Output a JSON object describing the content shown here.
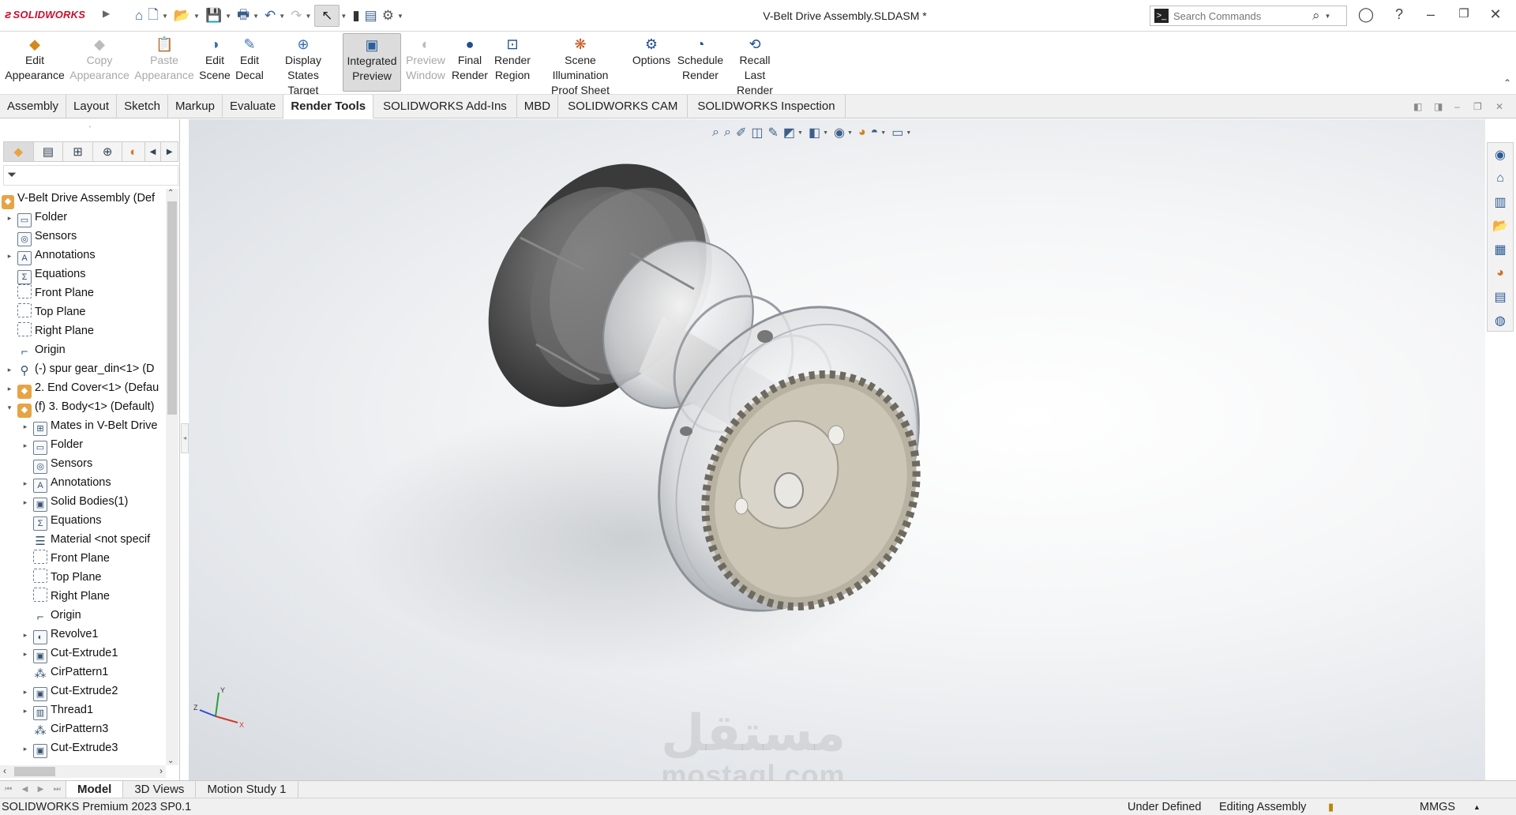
{
  "app": {
    "logo_text": "SOLIDWORKS",
    "window_title": "V-Belt Drive Assembly.SLDASM *"
  },
  "search": {
    "placeholder": "Search Commands"
  },
  "ribbon": {
    "buttons": [
      {
        "line1": "Edit",
        "line2": "Appearance",
        "icon": "edit-appearance-icon",
        "enabled": true
      },
      {
        "line1": "Copy",
        "line2": "Appearance",
        "icon": "copy-appearance-icon",
        "enabled": false
      },
      {
        "line1": "Paste",
        "line2": "Appearance",
        "icon": "paste-appearance-icon",
        "enabled": false
      },
      {
        "line1": "Edit",
        "line2": "Scene",
        "icon": "edit-scene-icon",
        "enabled": true
      },
      {
        "line1": "Edit",
        "line2": "Decal",
        "icon": "edit-decal-icon",
        "enabled": true
      },
      {
        "line1": "Display States",
        "line2": "Target",
        "icon": "display-states-target-icon",
        "enabled": true
      },
      {
        "line1": "Integrated",
        "line2": "Preview",
        "icon": "integrated-preview-icon",
        "enabled": true,
        "active": true
      },
      {
        "line1": "Preview",
        "line2": "Window",
        "icon": "preview-window-icon",
        "enabled": false
      },
      {
        "line1": "Final",
        "line2": "Render",
        "icon": "final-render-icon",
        "enabled": true
      },
      {
        "line1": "Render",
        "line2": "Region",
        "icon": "render-region-icon",
        "enabled": true
      },
      {
        "line1": "Scene Illumination",
        "line2": "Proof Sheet",
        "icon": "scene-illumination-icon",
        "enabled": true
      },
      {
        "line1": "Options",
        "line2": "",
        "icon": "options-icon",
        "enabled": true
      },
      {
        "line1": "Schedule",
        "line2": "Render",
        "icon": "schedule-render-icon",
        "enabled": true
      },
      {
        "line1": "Recall Last",
        "line2": "Render",
        "icon": "recall-last-render-icon",
        "enabled": true
      }
    ]
  },
  "command_tabs": [
    "Assembly",
    "Layout",
    "Sketch",
    "Markup",
    "Evaluate",
    "Render Tools",
    "SOLIDWORKS Add-Ins",
    "MBD",
    "SOLIDWORKS CAM",
    "SOLIDWORKS Inspection"
  ],
  "active_command_tab": "Render Tools",
  "tree": {
    "root": "V-Belt Drive Assembly  (Def",
    "items": [
      {
        "label": "Folder",
        "level": 0,
        "toggle": "▸",
        "icon": "folder-icon"
      },
      {
        "label": "Sensors",
        "level": 0,
        "toggle": "",
        "icon": "sensors-icon"
      },
      {
        "label": "Annotations",
        "level": 0,
        "toggle": "▸",
        "icon": "annotations-icon"
      },
      {
        "label": "Equations",
        "level": 0,
        "toggle": "",
        "icon": "equations-icon"
      },
      {
        "label": "Front Plane",
        "level": 0,
        "toggle": "",
        "icon": "plane-icon"
      },
      {
        "label": "Top Plane",
        "level": 0,
        "toggle": "",
        "icon": "plane-icon"
      },
      {
        "label": "Right Plane",
        "level": 0,
        "toggle": "",
        "icon": "plane-icon"
      },
      {
        "label": "Origin",
        "level": 0,
        "toggle": "",
        "icon": "origin-icon"
      },
      {
        "label": "(-) spur gear_din<1> (D",
        "level": 0,
        "toggle": "▸",
        "icon": "library-part-icon"
      },
      {
        "label": "2. End Cover<1> (Defau",
        "level": 0,
        "toggle": "▸",
        "icon": "part-icon"
      },
      {
        "label": "(f) 3. Body<1> (Default)",
        "level": 0,
        "toggle": "▾",
        "icon": "part-icon"
      },
      {
        "label": "Mates in V-Belt Drive",
        "level": 1,
        "toggle": "▸",
        "icon": "mates-icon"
      },
      {
        "label": "Folder",
        "level": 1,
        "toggle": "▸",
        "icon": "folder-icon"
      },
      {
        "label": "Sensors",
        "level": 1,
        "toggle": "",
        "icon": "sensors-icon"
      },
      {
        "label": "Annotations",
        "level": 1,
        "toggle": "▸",
        "icon": "annotations-icon"
      },
      {
        "label": "Solid Bodies(1)",
        "level": 1,
        "toggle": "▸",
        "icon": "solid-bodies-icon"
      },
      {
        "label": "Equations",
        "level": 1,
        "toggle": "",
        "icon": "equations-icon"
      },
      {
        "label": "Material <not specif",
        "level": 1,
        "toggle": "",
        "icon": "material-icon"
      },
      {
        "label": "Front Plane",
        "level": 1,
        "toggle": "",
        "icon": "plane-icon"
      },
      {
        "label": "Top Plane",
        "level": 1,
        "toggle": "",
        "icon": "plane-icon"
      },
      {
        "label": "Right Plane",
        "level": 1,
        "toggle": "",
        "icon": "plane-icon"
      },
      {
        "label": "Origin",
        "level": 1,
        "toggle": "",
        "icon": "origin-icon"
      },
      {
        "label": "Revolve1",
        "level": 1,
        "toggle": "▸",
        "icon": "revolve-icon"
      },
      {
        "label": "Cut-Extrude1",
        "level": 1,
        "toggle": "▸",
        "icon": "cut-extrude-icon"
      },
      {
        "label": "CirPattern1",
        "level": 1,
        "toggle": "",
        "icon": "circular-pattern-icon"
      },
      {
        "label": "Cut-Extrude2",
        "level": 1,
        "toggle": "▸",
        "icon": "cut-extrude-icon"
      },
      {
        "label": "Thread1",
        "level": 1,
        "toggle": "▸",
        "icon": "thread-icon"
      },
      {
        "label": "CirPattern3",
        "level": 1,
        "toggle": "",
        "icon": "circular-pattern-icon"
      },
      {
        "label": "Cut-Extrude3",
        "level": 1,
        "toggle": "▸",
        "icon": "cut-extrude-icon"
      }
    ]
  },
  "bottom_tabs": [
    "Model",
    "3D Views",
    "Motion Study 1"
  ],
  "active_bottom_tab": "Model",
  "watermark": {
    "arabic": "مستقل",
    "latin": "mostaql.com"
  },
  "triad": {
    "y": "Y",
    "x": "X",
    "z": "Z"
  },
  "status": {
    "version": "SOLIDWORKS Premium 2023 SP0.1",
    "definition": "Under Defined",
    "mode": "Editing Assembly",
    "units": "MMGS"
  },
  "colors": {
    "accent": "#c8102e",
    "icon_blue": "#3a5d8a",
    "part_orange": "#e6a446"
  }
}
